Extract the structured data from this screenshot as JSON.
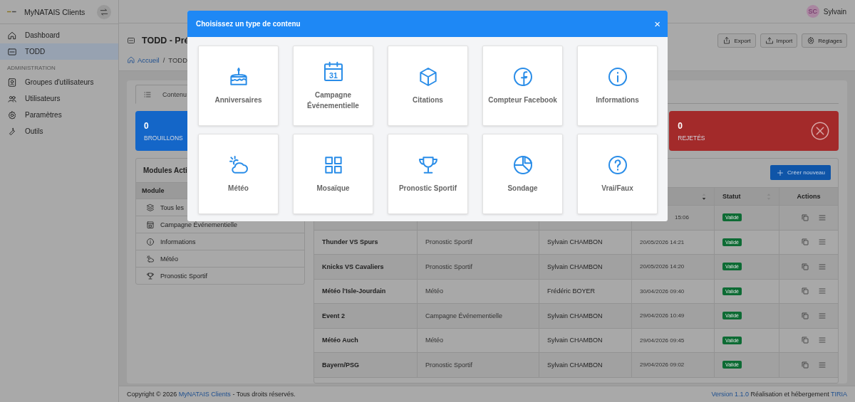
{
  "app": {
    "name": "MyNATAIS Clients"
  },
  "sidebar": {
    "items": [
      {
        "label": "Dashboard",
        "selected": false
      },
      {
        "label": "TODD",
        "selected": true
      }
    ],
    "section": "ADMINISTRATION",
    "admin_items": [
      {
        "label": "Groupes d'utilisateurs",
        "selected": false
      },
      {
        "label": "Utilisateurs",
        "selected": false
      },
      {
        "label": "Paramètres",
        "selected": false
      },
      {
        "label": "Outils",
        "selected": false
      }
    ]
  },
  "user": {
    "initials": "SC",
    "name": "Sylvain"
  },
  "page": {
    "title": "TODD - Pré",
    "actions": [
      "Export",
      "Import",
      "Réglages"
    ],
    "breadcrumb": [
      {
        "label": "Accueil",
        "link": true
      },
      {
        "label": "TODD",
        "link": false
      }
    ],
    "separator": "/"
  },
  "tabs": [
    {
      "label": "Contenu",
      "selected": true
    }
  ],
  "stats": [
    {
      "value": "0",
      "label": "BROUILLONS",
      "color": "#1466c8",
      "kind": "draft"
    },
    {
      "value": "0",
      "label": "REJETÉS",
      "color": "#a32a2a",
      "kind": "rejected"
    }
  ],
  "modules": {
    "title": "Modules Acti",
    "column": "Module",
    "items": [
      "Tous les",
      "Campagne Événementielle",
      "Informations",
      "Météo",
      "Pronostic Sportif"
    ]
  },
  "create_button": "Créer nouveau",
  "table": {
    "columns": [
      "Statut",
      "Actions"
    ],
    "rows": [
      {
        "date": "15:06",
        "status": "Validé"
      },
      {
        "title": "Thunder VS Spurs",
        "type": "Pronostic Sportif",
        "author": "Sylvain CHAMBON",
        "date": "20/05/2026 14:21",
        "status": "Validé"
      },
      {
        "title": "Knicks VS Cavaliers",
        "type": "Pronostic Sportif",
        "author": "Sylvain CHAMBON",
        "date": "20/05/2026 14:20",
        "status": "Validé"
      },
      {
        "title": "Météo l'Isle-Jourdain",
        "type": "Météo",
        "author": "Frédéric BOYER",
        "date": "30/04/2026 09:40",
        "status": "Validé"
      },
      {
        "title": "Event 2",
        "type": "Campagne Événementielle",
        "author": "Sylvain CHAMBON",
        "date": "29/04/2026 10:49",
        "status": "Validé"
      },
      {
        "title": "Météo Auch",
        "type": "Météo",
        "author": "Sylvain CHAMBON",
        "date": "29/04/2026 09:45",
        "status": "Validé"
      },
      {
        "title": "Bayern/PSG",
        "type": "Pronostic Sportif",
        "author": "Sylvain CHAMBON",
        "date": "29/04/2026 09:02",
        "status": "Validé"
      }
    ]
  },
  "footer": {
    "copyright": "Copyright © 2026",
    "brand": "MyNATAIS Clients",
    "rights": "- Tous droits réservés.",
    "version": "Version 1.1.0",
    "hosting": "Réalisation et hébergement",
    "host": "TIRIA"
  },
  "modal": {
    "title": "Choisissez un type de contenu",
    "close": "×",
    "options": [
      {
        "label": "Anniversaires"
      },
      {
        "label": "Campagne Événementielle",
        "icon_text": "31"
      },
      {
        "label": "Citations"
      },
      {
        "label": "Compteur Facebook"
      },
      {
        "label": "Informations"
      },
      {
        "label": "Météo"
      },
      {
        "label": "Mosaïque"
      },
      {
        "label": "Pronostic Sportif"
      },
      {
        "label": "Sondage"
      },
      {
        "label": "Vrai/Faux"
      }
    ]
  }
}
